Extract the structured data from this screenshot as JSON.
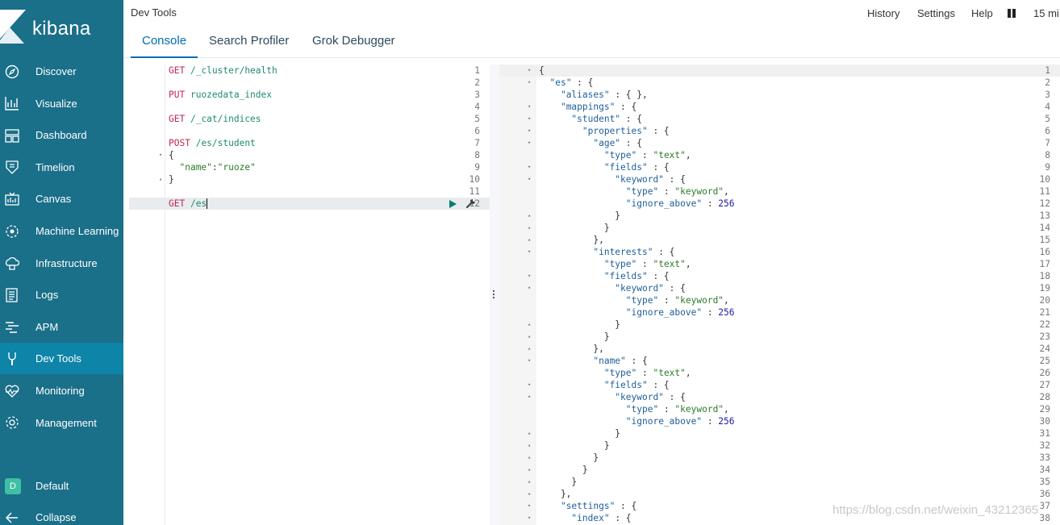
{
  "brand": {
    "name": "kibana"
  },
  "sidebar": {
    "items": [
      {
        "label": "Discover",
        "icon": "compass-icon"
      },
      {
        "label": "Visualize",
        "icon": "chart-icon"
      },
      {
        "label": "Dashboard",
        "icon": "dashboard-icon"
      },
      {
        "label": "Timelion",
        "icon": "timelion-icon"
      },
      {
        "label": "Canvas",
        "icon": "canvas-icon"
      },
      {
        "label": "Machine Learning",
        "icon": "ml-icon"
      },
      {
        "label": "Infrastructure",
        "icon": "infrastructure-icon"
      },
      {
        "label": "Logs",
        "icon": "logs-icon"
      },
      {
        "label": "APM",
        "icon": "apm-icon"
      },
      {
        "label": "Dev Tools",
        "icon": "wrench-icon",
        "active": true
      },
      {
        "label": "Monitoring",
        "icon": "heartbeat-icon"
      },
      {
        "label": "Management",
        "icon": "gear-icon"
      }
    ],
    "space": {
      "badge": "D",
      "label": "Default"
    },
    "collapse": {
      "label": "Collapse"
    }
  },
  "header": {
    "title": "Dev Tools",
    "links": [
      "History",
      "Settings",
      "Help"
    ],
    "time": "15 mi",
    "tabs": [
      "Console",
      "Search Profiler",
      "Grok Debugger"
    ],
    "active_tab": "Console"
  },
  "request_editor": {
    "lines": [
      "GET /_cluster/health",
      "",
      "PUT ruozedata_index",
      "",
      "GET /_cat/indices",
      "",
      "POST /es/student",
      "{",
      "  \"name\":\"ruoze\"",
      "}",
      "",
      "GET /es"
    ]
  },
  "response_editor": {
    "lines": [
      "{",
      "  \"es\" : {",
      "    \"aliases\" : { },",
      "    \"mappings\" : {",
      "      \"student\" : {",
      "        \"properties\" : {",
      "          \"age\" : {",
      "            \"type\" : \"text\",",
      "            \"fields\" : {",
      "              \"keyword\" : {",
      "                \"type\" : \"keyword\",",
      "                \"ignore_above\" : 256",
      "              }",
      "            }",
      "          },",
      "          \"interests\" : {",
      "            \"type\" : \"text\",",
      "            \"fields\" : {",
      "              \"keyword\" : {",
      "                \"type\" : \"keyword\",",
      "                \"ignore_above\" : 256",
      "              }",
      "            }",
      "          },",
      "          \"name\" : {",
      "            \"type\" : \"text\",",
      "            \"fields\" : {",
      "              \"keyword\" : {",
      "                \"type\" : \"keyword\",",
      "                \"ignore_above\" : 256",
      "              }",
      "            }",
      "          }",
      "        }",
      "      }",
      "    },",
      "    \"settings\" : {",
      "      \"index\" : {"
    ]
  },
  "watermark": "https://blog.csdn.net/weixin_43212365",
  "colors": {
    "sidebar": "#1a6f89",
    "sidebar_active": "#0e84a8",
    "accent": "#006bb4",
    "method": "#c7254e",
    "path": "#1f8a70"
  }
}
